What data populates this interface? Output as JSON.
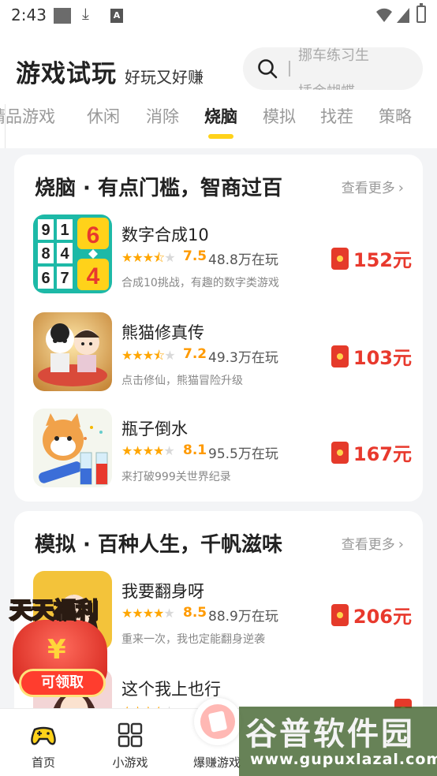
{
  "status_bar": {
    "time": "2:43"
  },
  "header": {
    "title": "游戏试玩",
    "subtitle": "好玩又好赚",
    "search_hint_top": "挪车练习生",
    "search_hint_bottom": "插金蝴蝶"
  },
  "tabs": [
    {
      "label": "精品游戏",
      "active": false
    },
    {
      "label": "休闲",
      "active": false
    },
    {
      "label": "消除",
      "active": false
    },
    {
      "label": "烧脑",
      "active": true
    },
    {
      "label": "模拟",
      "active": false
    },
    {
      "label": "找茬",
      "active": false
    },
    {
      "label": "策略",
      "active": false
    }
  ],
  "sections": [
    {
      "title": "烧脑 · 有点门槛，智商过百",
      "see_more": "查看更多",
      "games": [
        {
          "name": "数字合成10",
          "rating": "7.5",
          "rating_stars": 3.5,
          "players": "48.8万在玩",
          "desc": "合成10挑战，有趣的数字类游戏",
          "reward": "152元",
          "icon": "number-merge-icon"
        },
        {
          "name": "熊猫修真传",
          "rating": "7.2",
          "rating_stars": 3.5,
          "players": "49.3万在玩",
          "desc": "点击修仙，熊猫冒险升级",
          "reward": "103元",
          "icon": "panda-cultivation-icon"
        },
        {
          "name": "瓶子倒水",
          "rating": "8.1",
          "rating_stars": 4,
          "players": "95.5万在玩",
          "desc": "来打破999关世界纪录",
          "reward": "167元",
          "icon": "bottle-pour-icon"
        }
      ]
    },
    {
      "title": "模拟 · 百种人生，千帆滋味",
      "see_more": "查看更多",
      "games": [
        {
          "name": "我要翻身呀",
          "rating": "8.5",
          "rating_stars": 4,
          "players": "88.9万在玩",
          "desc": "重来一次，我也定能翻身逆袭",
          "reward": "206元",
          "icon": "comeback-game-icon"
        },
        {
          "name": "这个我上也行",
          "rating": "",
          "rating_stars": 4,
          "players": "",
          "desc": "",
          "reward": "",
          "icon": "game-icon"
        }
      ]
    }
  ],
  "promo": {
    "title_part1": "天天",
    "title_part2": "福利",
    "button": "可领取"
  },
  "bottom_nav": [
    {
      "label": "首页",
      "icon": "gamepad-icon",
      "active": true
    },
    {
      "label": "小游戏",
      "icon": "grid-icon",
      "active": false
    },
    {
      "label": "爆赚游戏",
      "icon": "money-icon",
      "active": false
    }
  ],
  "watermark": {
    "logo": "谷普软件园",
    "url": "www.gupuxlazal.com"
  },
  "colors": {
    "accent_yellow": "#ffd21a",
    "reward_red": "#e8392d",
    "star_orange": "#ffa600"
  }
}
